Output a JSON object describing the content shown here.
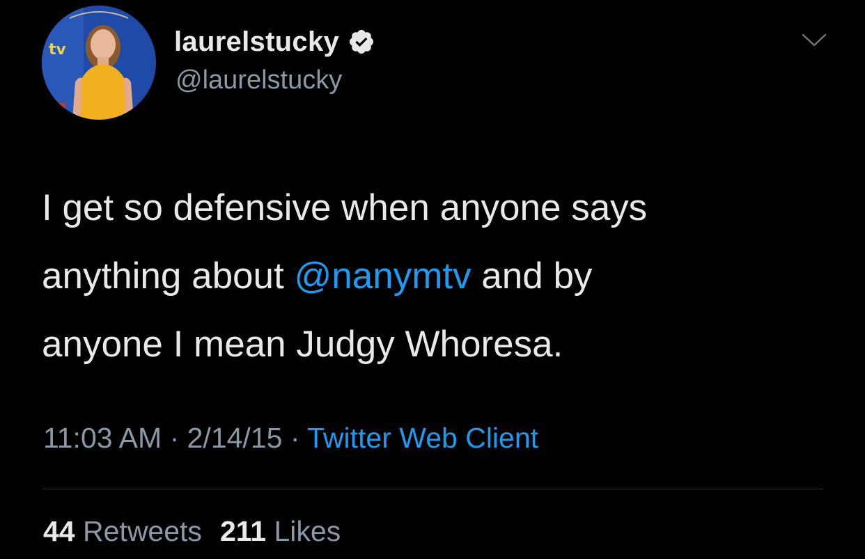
{
  "colors": {
    "background": "#000000",
    "text_primary": "#e7e9ea",
    "text_secondary": "#8b98a5",
    "accent": "#1d9bf0",
    "divider": "#2f3336"
  },
  "author": {
    "display_name": "laurelstucky",
    "handle": "@laurelstucky",
    "verified": true,
    "avatar_icon": "profile-photo",
    "badge_icon": "verified-badge-icon"
  },
  "menu": {
    "icon": "chevron-down-icon"
  },
  "tweet": {
    "line1": "I get so defensive when anyone says",
    "line2_before": "anything about ",
    "mention": "@nanymtv",
    "line2_after": " and by",
    "line3": "anyone I mean Judgy Whoresa."
  },
  "meta": {
    "time": "11:03 AM",
    "separator1": " · ",
    "date": "2/14/15",
    "separator2": " · ",
    "source": "Twitter Web Client"
  },
  "stats": {
    "retweets_count": "44",
    "retweets_label": "Retweets",
    "likes_count": "211",
    "likes_label": "Likes"
  }
}
